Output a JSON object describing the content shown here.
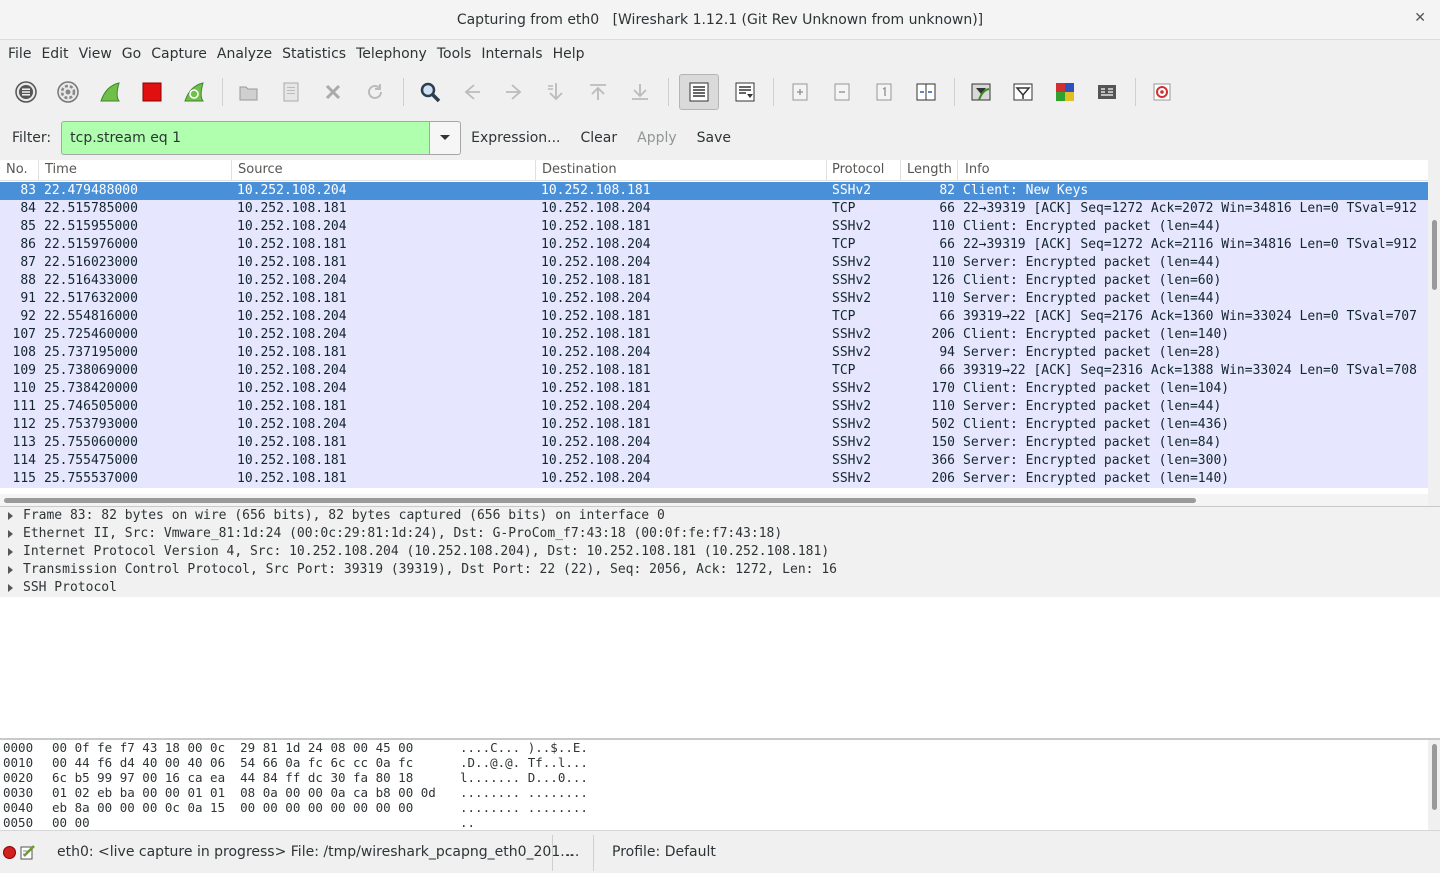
{
  "window": {
    "title_prefix": "Capturing from eth0",
    "title_app": "[Wireshark 1.12.1  (Git Rev Unknown from unknown)]",
    "close_glyph": "✕"
  },
  "menu": [
    "File",
    "Edit",
    "View",
    "Go",
    "Capture",
    "Analyze",
    "Statistics",
    "Telephony",
    "Tools",
    "Internals",
    "Help"
  ],
  "toolbar": {
    "icons": [
      "interfaces-icon",
      "options-icon",
      "start-capture-icon",
      "stop-capture-icon",
      "restart-capture-icon",
      "open-file-icon",
      "save-file-icon",
      "close-file-icon",
      "reload-icon",
      "find-packet-icon",
      "go-back-icon",
      "go-forward-icon",
      "go-to-packet-icon",
      "go-first-icon",
      "go-last-icon",
      "colorize-icon",
      "auto-scroll-icon",
      "zoom-in-icon",
      "zoom-out-icon",
      "normal-size-icon",
      "resize-columns-icon",
      "capture-filters-icon",
      "display-filters-icon",
      "coloring-rules-icon",
      "preferences-icon",
      "help-icon"
    ]
  },
  "filter": {
    "label": "Filter:",
    "value": "tcp.stream eq 1",
    "expression": "Expression...",
    "clear": "Clear",
    "apply": "Apply",
    "save": "Save",
    "bg_color": "#afffaf"
  },
  "packet_list": {
    "columns": [
      "No.",
      "Time",
      "Source",
      "Destination",
      "Protocol",
      "Length",
      "Info"
    ],
    "rows": [
      {
        "no": "83",
        "time": "22.479488000",
        "src": "10.252.108.204",
        "dst": "10.252.108.181",
        "proto": "SSHv2",
        "len": "82",
        "info": "Client: New Keys"
      },
      {
        "no": "84",
        "time": "22.515785000",
        "src": "10.252.108.181",
        "dst": "10.252.108.204",
        "proto": "TCP",
        "len": "66",
        "info": "22→39319 [ACK] Seq=1272 Ack=2072 Win=34816 Len=0 TSval=912"
      },
      {
        "no": "85",
        "time": "22.515955000",
        "src": "10.252.108.204",
        "dst": "10.252.108.181",
        "proto": "SSHv2",
        "len": "110",
        "info": "Client: Encrypted packet (len=44)"
      },
      {
        "no": "86",
        "time": "22.515976000",
        "src": "10.252.108.181",
        "dst": "10.252.108.204",
        "proto": "TCP",
        "len": "66",
        "info": "22→39319 [ACK] Seq=1272 Ack=2116 Win=34816 Len=0 TSval=912"
      },
      {
        "no": "87",
        "time": "22.516023000",
        "src": "10.252.108.181",
        "dst": "10.252.108.204",
        "proto": "SSHv2",
        "len": "110",
        "info": "Server: Encrypted packet (len=44)"
      },
      {
        "no": "88",
        "time": "22.516433000",
        "src": "10.252.108.204",
        "dst": "10.252.108.181",
        "proto": "SSHv2",
        "len": "126",
        "info": "Client: Encrypted packet (len=60)"
      },
      {
        "no": "91",
        "time": "22.517632000",
        "src": "10.252.108.181",
        "dst": "10.252.108.204",
        "proto": "SSHv2",
        "len": "110",
        "info": "Server: Encrypted packet (len=44)"
      },
      {
        "no": "92",
        "time": "22.554816000",
        "src": "10.252.108.204",
        "dst": "10.252.108.181",
        "proto": "TCP",
        "len": "66",
        "info": "39319→22 [ACK] Seq=2176 Ack=1360 Win=33024 Len=0 TSval=707"
      },
      {
        "no": "107",
        "time": "25.725460000",
        "src": "10.252.108.204",
        "dst": "10.252.108.181",
        "proto": "SSHv2",
        "len": "206",
        "info": "Client: Encrypted packet (len=140)"
      },
      {
        "no": "108",
        "time": "25.737195000",
        "src": "10.252.108.181",
        "dst": "10.252.108.204",
        "proto": "SSHv2",
        "len": "94",
        "info": "Server: Encrypted packet (len=28)"
      },
      {
        "no": "109",
        "time": "25.738069000",
        "src": "10.252.108.204",
        "dst": "10.252.108.181",
        "proto": "TCP",
        "len": "66",
        "info": "39319→22 [ACK] Seq=2316 Ack=1388 Win=33024 Len=0 TSval=708"
      },
      {
        "no": "110",
        "time": "25.738420000",
        "src": "10.252.108.204",
        "dst": "10.252.108.181",
        "proto": "SSHv2",
        "len": "170",
        "info": "Client: Encrypted packet (len=104)"
      },
      {
        "no": "111",
        "time": "25.746505000",
        "src": "10.252.108.181",
        "dst": "10.252.108.204",
        "proto": "SSHv2",
        "len": "110",
        "info": "Server: Encrypted packet (len=44)"
      },
      {
        "no": "112",
        "time": "25.753793000",
        "src": "10.252.108.204",
        "dst": "10.252.108.181",
        "proto": "SSHv2",
        "len": "502",
        "info": "Client: Encrypted packet (len=436)"
      },
      {
        "no": "113",
        "time": "25.755060000",
        "src": "10.252.108.181",
        "dst": "10.252.108.204",
        "proto": "SSHv2",
        "len": "150",
        "info": "Server: Encrypted packet (len=84)"
      },
      {
        "no": "114",
        "time": "25.755475000",
        "src": "10.252.108.181",
        "dst": "10.252.108.204",
        "proto": "SSHv2",
        "len": "366",
        "info": "Server: Encrypted packet (len=300)"
      },
      {
        "no": "115",
        "time": "25.755537000",
        "src": "10.252.108.181",
        "dst": "10.252.108.204",
        "proto": "SSHv2",
        "len": "206",
        "info": "Server: Encrypted packet (len=140)"
      }
    ],
    "selected_index": 0,
    "row_bg": "#e7e6ff",
    "selected_bg": "#4a90d9"
  },
  "details": [
    "Frame 83: 82 bytes on wire (656 bits), 82 bytes captured (656 bits) on interface 0",
    "Ethernet II, Src: Vmware_81:1d:24 (00:0c:29:81:1d:24), Dst: G-ProCom_f7:43:18 (00:0f:fe:f7:43:18)",
    "Internet Protocol Version 4, Src: 10.252.108.204 (10.252.108.204), Dst: 10.252.108.181 (10.252.108.181)",
    "Transmission Control Protocol, Src Port: 39319 (39319), Dst Port: 22 (22), Seq: 2056, Ack: 1272, Len: 16",
    "SSH Protocol"
  ],
  "hex": [
    {
      "off": "0000",
      "hex": "00 0f fe f7 43 18 00 0c  29 81 1d 24 08 00 45 00",
      "asc": "....C... )..$..E."
    },
    {
      "off": "0010",
      "hex": "00 44 f6 d4 40 00 40 06  54 66 0a fc 6c cc 0a fc",
      "asc": ".D..@.@. Tf..l..."
    },
    {
      "off": "0020",
      "hex": "6c b5 99 97 00 16 ca ea  44 84 ff dc 30 fa 80 18",
      "asc": "l....... D...0..."
    },
    {
      "off": "0030",
      "hex": "01 02 eb ba 00 00 01 01  08 0a 00 00 0a ca b8 00 0d",
      "asc": "........ ........"
    },
    {
      "off": "0040",
      "hex": "eb 8a 00 00 00 0c 0a 15  00 00 00 00 00 00 00 00",
      "asc": "........ ........"
    },
    {
      "off": "0050",
      "hex": "00 00",
      "asc": ".."
    }
  ],
  "status": {
    "capture_text": "eth0: <live capture in progress> File: /tmp/wireshark_pcapng_eth0_201...",
    "packets_text": "...",
    "profile_text": "Profile: Default"
  }
}
